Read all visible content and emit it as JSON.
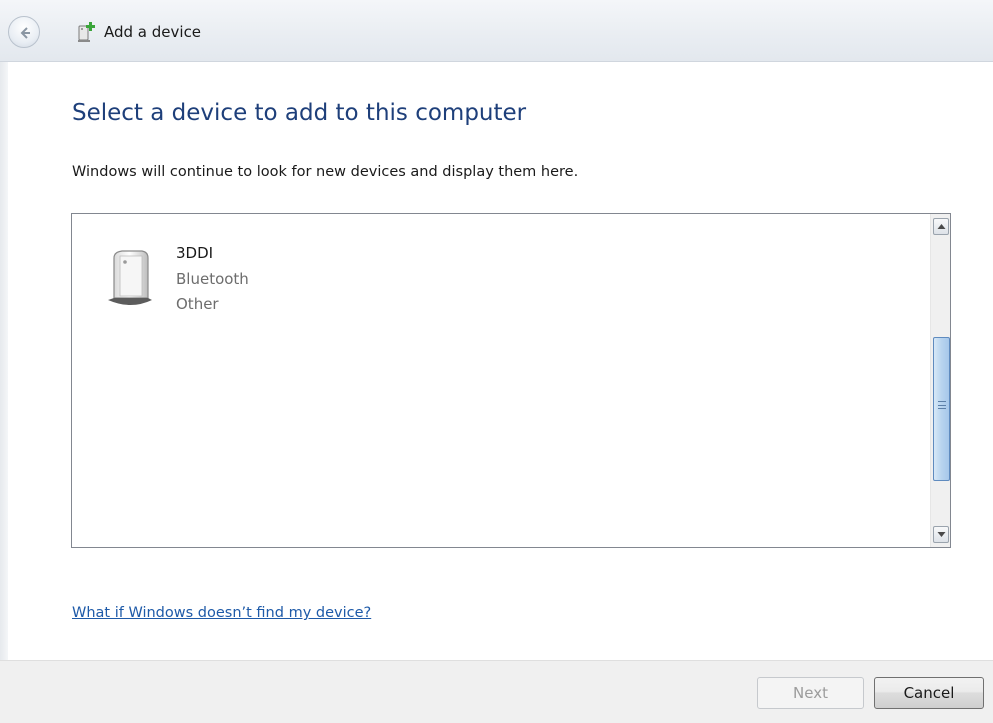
{
  "window": {
    "title": "Add a device"
  },
  "main": {
    "heading": "Select a device to add to this computer",
    "subtext": "Windows will continue to look for new devices and display them here.",
    "devices": [
      {
        "name": "3DDI",
        "type": "Bluetooth",
        "category": "Other",
        "icon": "generic-device-icon"
      }
    ],
    "help_link": "What if Windows doesn’t find my device?"
  },
  "footer": {
    "next_label": "Next",
    "cancel_label": "Cancel"
  },
  "colors": {
    "heading": "#1e3f7a",
    "link": "#1e5aa8",
    "scroll_thumb": "#b8d4ef"
  }
}
